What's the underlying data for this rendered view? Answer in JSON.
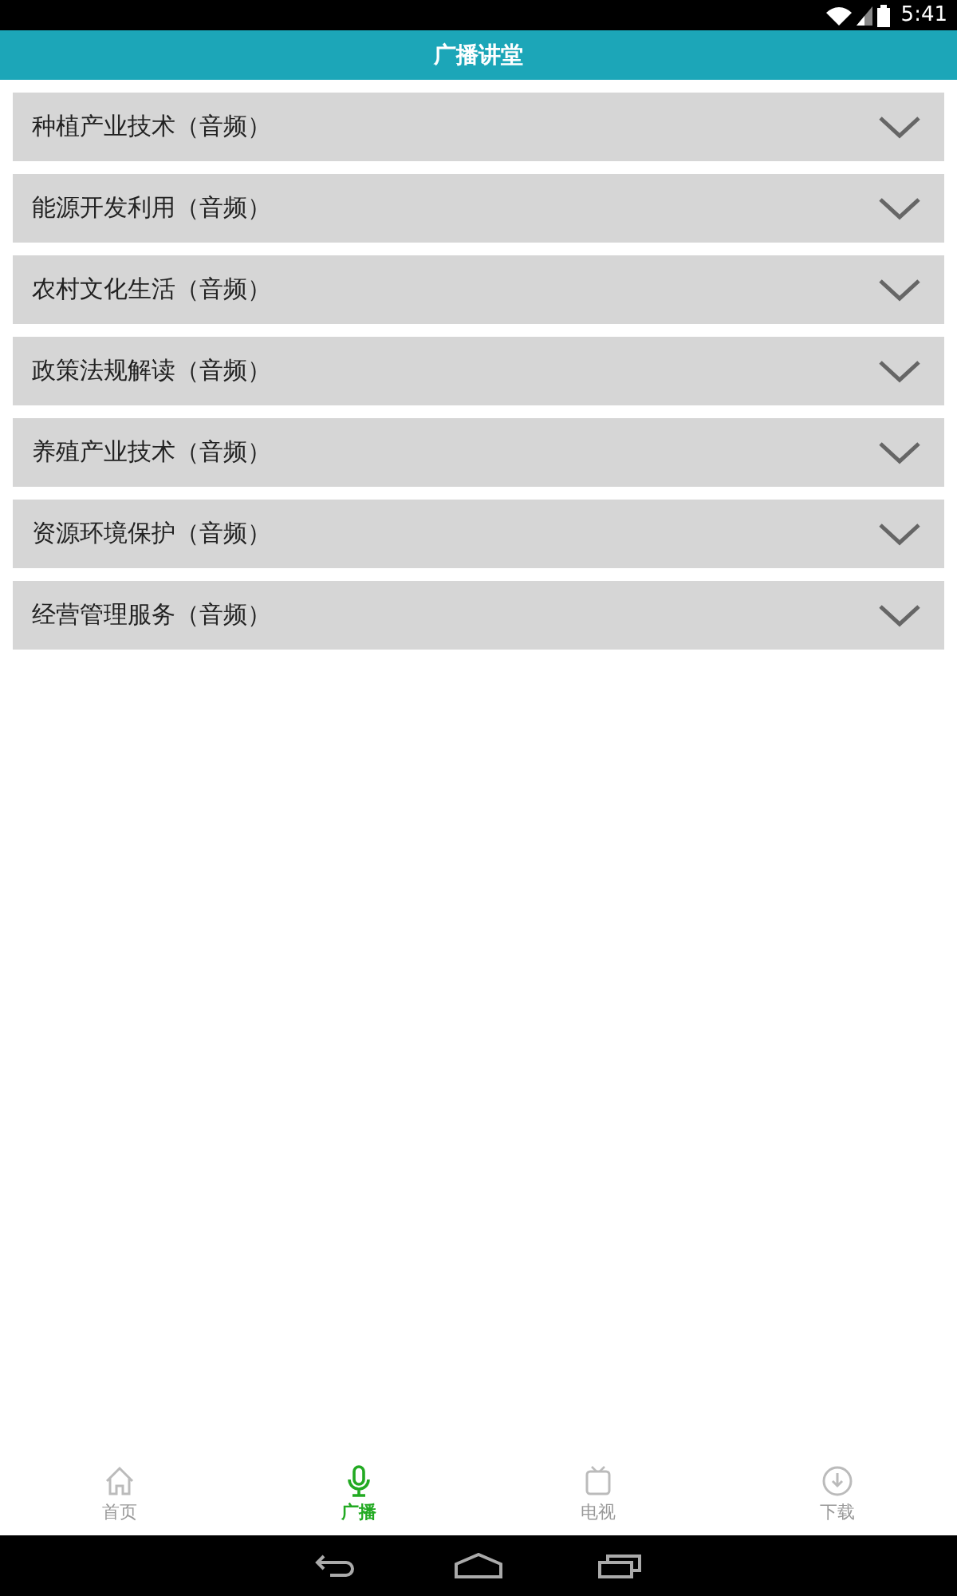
{
  "status_bar": {
    "time": "5:41"
  },
  "header": {
    "title": "广播讲堂"
  },
  "categories": [
    {
      "label": "种植产业技术（音频）",
      "expanded": false
    },
    {
      "label": "能源开发利用（音频）",
      "expanded": false
    },
    {
      "label": "农村文化生活（音频）",
      "expanded": false
    },
    {
      "label": "政策法规解读（音频）",
      "expanded": false
    },
    {
      "label": "养殖产业技术（音频）",
      "expanded": false
    },
    {
      "label": "资源环境保护（音频）",
      "expanded": false
    },
    {
      "label": "经营管理服务（音频）",
      "expanded": false
    }
  ],
  "tabs": [
    {
      "label": "首页",
      "kind": "home",
      "selected": false
    },
    {
      "label": "广播",
      "kind": "radio",
      "selected": true
    },
    {
      "label": "电视",
      "kind": "tv",
      "selected": false
    },
    {
      "label": "下载",
      "kind": "download",
      "selected": false
    }
  ]
}
